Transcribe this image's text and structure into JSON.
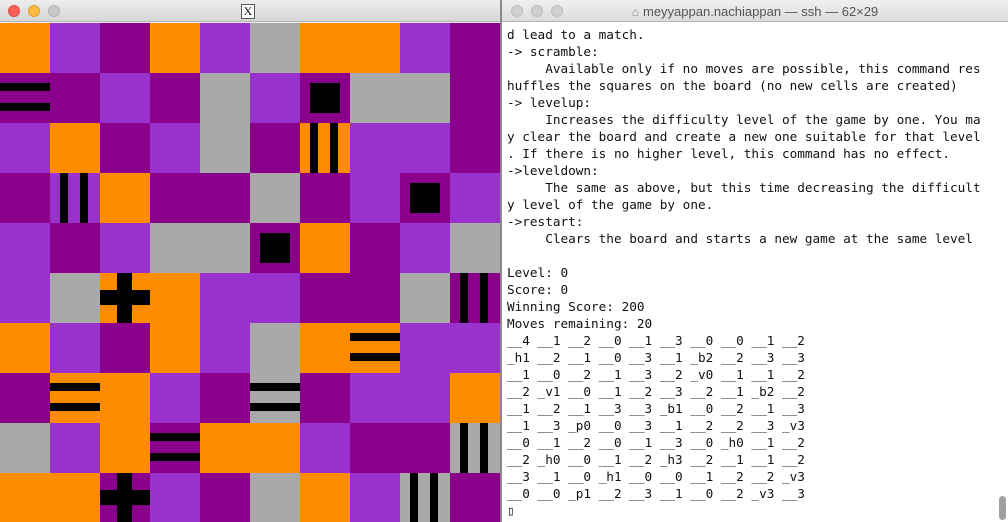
{
  "x_window": {
    "icon_label": "X",
    "board": {
      "rows": [
        [
          "o",
          "p",
          "m",
          "o",
          "p",
          "g",
          "o",
          "o",
          "p",
          "m"
        ],
        [
          "m",
          "m",
          "p",
          "m",
          "g",
          "p",
          "m",
          "g",
          "g",
          "m"
        ],
        [
          "p",
          "o",
          "m",
          "p",
          "g",
          "m",
          "o",
          "p",
          "p",
          "m"
        ],
        [
          "m",
          "p",
          "o",
          "m",
          "m",
          "g",
          "m",
          "p",
          "m",
          "p"
        ],
        [
          "p",
          "m",
          "p",
          "g",
          "g",
          "m",
          "o",
          "m",
          "p",
          "g"
        ],
        [
          "p",
          "g",
          "o",
          "o",
          "p",
          "p",
          "m",
          "m",
          "g",
          "m"
        ],
        [
          "o",
          "p",
          "m",
          "o",
          "p",
          "g",
          "o",
          "o",
          "p",
          "p"
        ],
        [
          "m",
          "o",
          "o",
          "p",
          "m",
          "g",
          "m",
          "p",
          "p",
          "o"
        ],
        [
          "g",
          "p",
          "o",
          "m",
          "o",
          "o",
          "p",
          "m",
          "m",
          "g"
        ],
        [
          "o",
          "o",
          "m",
          "p",
          "m",
          "g",
          "o",
          "p",
          "g",
          "m"
        ]
      ],
      "marks": [
        {
          "r": 1,
          "c": 0,
          "t": "h"
        },
        {
          "r": 1,
          "c": 6,
          "t": "b"
        },
        {
          "r": 2,
          "c": 6,
          "t": "v"
        },
        {
          "r": 3,
          "c": 1,
          "t": "v"
        },
        {
          "r": 3,
          "c": 8,
          "t": "b"
        },
        {
          "r": 4,
          "c": 5,
          "t": "b"
        },
        {
          "r": 5,
          "c": 2,
          "t": "p"
        },
        {
          "r": 5,
          "c": 9,
          "t": "v"
        },
        {
          "r": 6,
          "c": 7,
          "t": "h"
        },
        {
          "r": 7,
          "c": 1,
          "t": "h"
        },
        {
          "r": 7,
          "c": 5,
          "t": "h"
        },
        {
          "r": 8,
          "c": 3,
          "t": "h"
        },
        {
          "r": 8,
          "c": 9,
          "t": "v"
        },
        {
          "r": 9,
          "c": 2,
          "t": "p"
        },
        {
          "r": 9,
          "c": 8,
          "t": "v"
        }
      ]
    },
    "colors": {
      "o": "#ff8c00",
      "p": "#9932cc",
      "m": "#8b008b",
      "g": "#a9a9a9"
    }
  },
  "terminal": {
    "title": "meyyappan.nachiappan — ssh — 62×29",
    "lines": [
      "d lead to a match.",
      "-> scramble:",
      "     Available only if no moves are possible, this command res",
      "huffles the squares on the board (no new cells are created)",
      "-> levelup:",
      "     Increases the difficulty level of the game by one. You ma",
      "y clear the board and create a new one suitable for that level",
      ". If there is no higher level, this command has no effect.",
      "->leveldown:",
      "     The same as above, but this time decreasing the difficult",
      "y level of the game by one.",
      "->restart:",
      "     Clears the board and starts a new game at the same level",
      "",
      "Level: 0",
      "Score: 0",
      "Winning Score: 200",
      "Moves remaining: 20",
      "__4 __1 __2 __0 __1 __3 __0 __0 __1 __2",
      "_h1 __2 __1 __0 __3 __1 _b2 __2 __3 __3",
      "__1 __0 __2 __1 __3 __2 _v0 __1 __1 __2",
      "__2 _v1 __0 __1 __2 __3 __2 __1 _b2 __2",
      "__1 __2 __1 __3 __3 _b1 __0 __2 __1 __3",
      "__1 __3 _p0 __0 __3 __1 __2 __2 __3 _v3",
      "__0 __1 __2 __0 __1 __3 __0 _h0 __1 __2",
      "__2 _h0 __0 __1 __2 _h3 __2 __1 __1 __2",
      "__3 __1 __0 _h1 __0 __0 __1 __2 __2 _v3",
      "__0 __0 _p1 __2 __3 __1 __0 __2 _v3 __3",
      "▯"
    ]
  }
}
